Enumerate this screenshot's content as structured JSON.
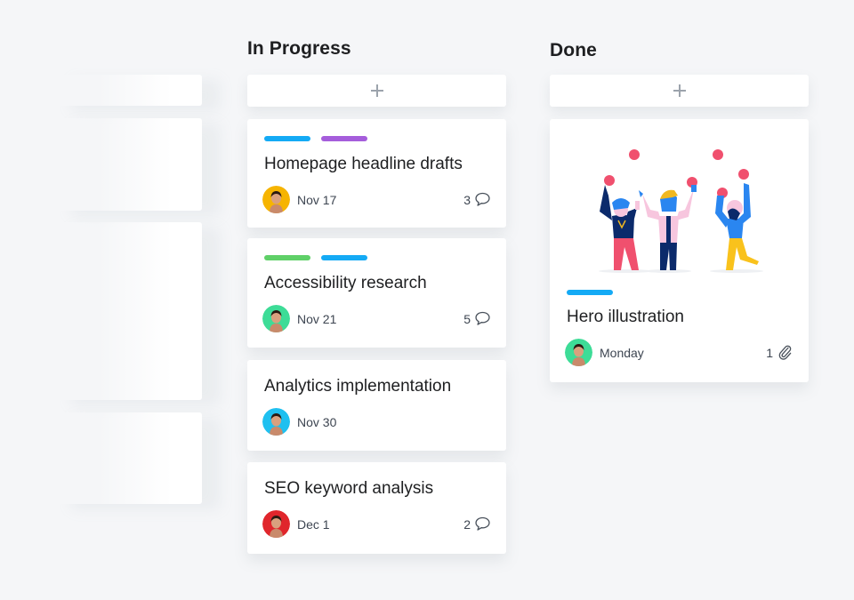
{
  "board": {
    "columns": [
      {
        "title": "In Progress",
        "add_label": "+",
        "cards": [
          {
            "title": "Homepage headline drafts",
            "tags": [
              "#14aaf5",
              "#a55ddb"
            ],
            "date": "Nov 17",
            "count": "3",
            "count_icon": "comment-icon",
            "avatar_bg": "#f6b400"
          },
          {
            "title": "Accessibility research",
            "tags": [
              "#5fd068",
              "#14aaf5"
            ],
            "date": "Nov 21",
            "count": "5",
            "count_icon": "comment-icon",
            "avatar_bg": "#3ddc97"
          },
          {
            "title": "Analytics implementation",
            "tags": [],
            "date": "Nov 30",
            "count": "",
            "count_icon": "",
            "avatar_bg": "#1fc0f0"
          },
          {
            "title": "SEO keyword analysis",
            "tags": [],
            "date": "Dec 1",
            "count": "2",
            "count_icon": "comment-icon",
            "avatar_bg": "#e0262c"
          }
        ]
      },
      {
        "title": "Done",
        "add_label": "+",
        "cards": [
          {
            "title": "Hero illustration",
            "tags": [
              "#14aaf5"
            ],
            "date": "Monday",
            "count": "1",
            "count_icon": "paperclip-icon",
            "avatar_bg": "#3ddc97",
            "illustration": "celebrating-people-juggling"
          }
        ]
      }
    ]
  },
  "colors": {
    "background": "#f5f6f8",
    "card": "#ffffff",
    "text": "#1e1f21",
    "muted_text": "#3d4551",
    "icon": "#9ca3ac",
    "juggle_ball": "#f0506e"
  }
}
